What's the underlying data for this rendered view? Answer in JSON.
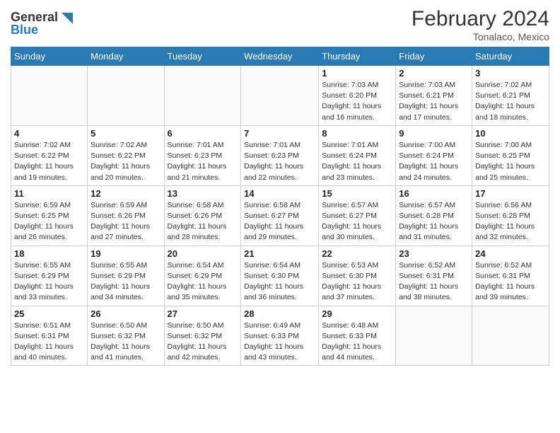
{
  "logo": {
    "line1": "General",
    "line2": "Blue"
  },
  "title": "February 2024",
  "location": "Tonalaco, Mexico",
  "days_of_week": [
    "Sunday",
    "Monday",
    "Tuesday",
    "Wednesday",
    "Thursday",
    "Friday",
    "Saturday"
  ],
  "weeks": [
    [
      {
        "day": "",
        "info": ""
      },
      {
        "day": "",
        "info": ""
      },
      {
        "day": "",
        "info": ""
      },
      {
        "day": "",
        "info": ""
      },
      {
        "day": "1",
        "info": "Sunrise: 7:03 AM\nSunset: 6:20 PM\nDaylight: 11 hours and 16 minutes."
      },
      {
        "day": "2",
        "info": "Sunrise: 7:03 AM\nSunset: 6:21 PM\nDaylight: 11 hours and 17 minutes."
      },
      {
        "day": "3",
        "info": "Sunrise: 7:02 AM\nSunset: 6:21 PM\nDaylight: 11 hours and 18 minutes."
      }
    ],
    [
      {
        "day": "4",
        "info": "Sunrise: 7:02 AM\nSunset: 6:22 PM\nDaylight: 11 hours and 19 minutes."
      },
      {
        "day": "5",
        "info": "Sunrise: 7:02 AM\nSunset: 6:22 PM\nDaylight: 11 hours and 20 minutes."
      },
      {
        "day": "6",
        "info": "Sunrise: 7:01 AM\nSunset: 6:23 PM\nDaylight: 11 hours and 21 minutes."
      },
      {
        "day": "7",
        "info": "Sunrise: 7:01 AM\nSunset: 6:23 PM\nDaylight: 11 hours and 22 minutes."
      },
      {
        "day": "8",
        "info": "Sunrise: 7:01 AM\nSunset: 6:24 PM\nDaylight: 11 hours and 23 minutes."
      },
      {
        "day": "9",
        "info": "Sunrise: 7:00 AM\nSunset: 6:24 PM\nDaylight: 11 hours and 24 minutes."
      },
      {
        "day": "10",
        "info": "Sunrise: 7:00 AM\nSunset: 6:25 PM\nDaylight: 11 hours and 25 minutes."
      }
    ],
    [
      {
        "day": "11",
        "info": "Sunrise: 6:59 AM\nSunset: 6:25 PM\nDaylight: 11 hours and 26 minutes."
      },
      {
        "day": "12",
        "info": "Sunrise: 6:59 AM\nSunset: 6:26 PM\nDaylight: 11 hours and 27 minutes."
      },
      {
        "day": "13",
        "info": "Sunrise: 6:58 AM\nSunset: 6:26 PM\nDaylight: 11 hours and 28 minutes."
      },
      {
        "day": "14",
        "info": "Sunrise: 6:58 AM\nSunset: 6:27 PM\nDaylight: 11 hours and 29 minutes."
      },
      {
        "day": "15",
        "info": "Sunrise: 6:57 AM\nSunset: 6:27 PM\nDaylight: 11 hours and 30 minutes."
      },
      {
        "day": "16",
        "info": "Sunrise: 6:57 AM\nSunset: 6:28 PM\nDaylight: 11 hours and 31 minutes."
      },
      {
        "day": "17",
        "info": "Sunrise: 6:56 AM\nSunset: 6:28 PM\nDaylight: 11 hours and 32 minutes."
      }
    ],
    [
      {
        "day": "18",
        "info": "Sunrise: 6:55 AM\nSunset: 6:29 PM\nDaylight: 11 hours and 33 minutes."
      },
      {
        "day": "19",
        "info": "Sunrise: 6:55 AM\nSunset: 6:29 PM\nDaylight: 11 hours and 34 minutes."
      },
      {
        "day": "20",
        "info": "Sunrise: 6:54 AM\nSunset: 6:29 PM\nDaylight: 11 hours and 35 minutes."
      },
      {
        "day": "21",
        "info": "Sunrise: 6:54 AM\nSunset: 6:30 PM\nDaylight: 11 hours and 36 minutes."
      },
      {
        "day": "22",
        "info": "Sunrise: 6:53 AM\nSunset: 6:30 PM\nDaylight: 11 hours and 37 minutes."
      },
      {
        "day": "23",
        "info": "Sunrise: 6:52 AM\nSunset: 6:31 PM\nDaylight: 11 hours and 38 minutes."
      },
      {
        "day": "24",
        "info": "Sunrise: 6:52 AM\nSunset: 6:31 PM\nDaylight: 11 hours and 39 minutes."
      }
    ],
    [
      {
        "day": "25",
        "info": "Sunrise: 6:51 AM\nSunset: 6:31 PM\nDaylight: 11 hours and 40 minutes."
      },
      {
        "day": "26",
        "info": "Sunrise: 6:50 AM\nSunset: 6:32 PM\nDaylight: 11 hours and 41 minutes."
      },
      {
        "day": "27",
        "info": "Sunrise: 6:50 AM\nSunset: 6:32 PM\nDaylight: 11 hours and 42 minutes."
      },
      {
        "day": "28",
        "info": "Sunrise: 6:49 AM\nSunset: 6:33 PM\nDaylight: 11 hours and 43 minutes."
      },
      {
        "day": "29",
        "info": "Sunrise: 6:48 AM\nSunset: 6:33 PM\nDaylight: 11 hours and 44 minutes."
      },
      {
        "day": "",
        "info": ""
      },
      {
        "day": "",
        "info": ""
      }
    ]
  ]
}
